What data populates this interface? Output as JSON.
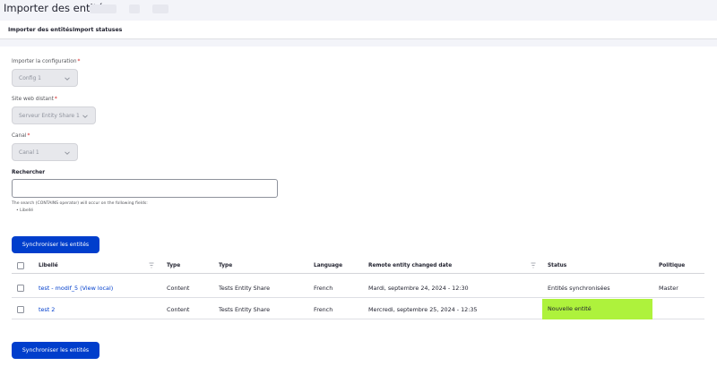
{
  "page": {
    "title": "Importer des entités"
  },
  "tabs": [
    {
      "label": "Importer des entités"
    },
    {
      "label": "Import statuses"
    }
  ],
  "form": {
    "config": {
      "label": "Importer la configuration",
      "required": "*",
      "value": "Config 1"
    },
    "remote": {
      "label": "Site web distant",
      "required": "*",
      "value": "Serveur Entity Share 1"
    },
    "channel": {
      "label": "Canal",
      "required": "*",
      "value": "Canal 1"
    },
    "search": {
      "label": "Rechercher",
      "value": "",
      "help": "The search (CONTAINS operator) will occur on the following fields:",
      "fields": [
        "Libellé"
      ]
    }
  },
  "actions": {
    "sync_label": "Synchroniser les entités"
  },
  "table": {
    "columns": [
      "Libellé",
      "Type",
      "Type",
      "Language",
      "Remote entity changed date",
      "Status",
      "Politique"
    ],
    "rows": [
      {
        "label": "test - modif_5 (View local)",
        "type": "Content",
        "bundle": "Tests Entity Share",
        "language": "French",
        "changed": "Mardi, septembre 24, 2024 - 12:30",
        "status": "Entités synchronisées",
        "policy": "Master"
      },
      {
        "label": "test 2",
        "type": "Content",
        "bundle": "Tests Entity Share",
        "language": "French",
        "changed": "Mercredi, septembre 25, 2024 - 12:35",
        "status": "Nouvelle entité",
        "policy": ""
      }
    ]
  },
  "colors": {
    "primary": "#003ecc",
    "new_entity_highlight": "#aef23c",
    "required": "#d72222"
  },
  "icons": [
    "chevron-down-icon",
    "sort-icon",
    "checkbox-icon"
  ]
}
